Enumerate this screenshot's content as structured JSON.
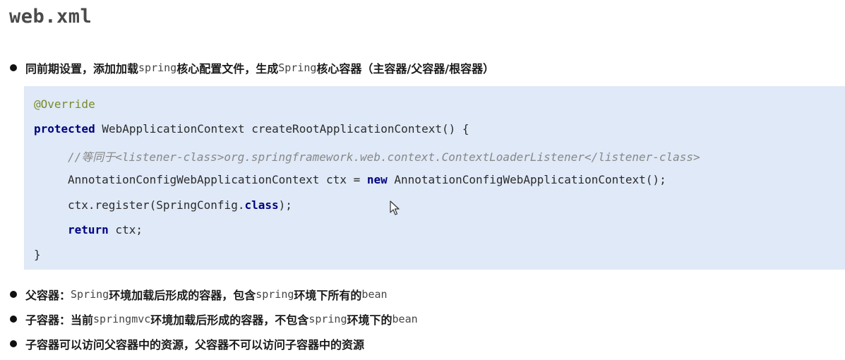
{
  "page_title": "web.xml",
  "bullet1": {
    "p1": "同前期设置，添加加载",
    "m1": "spring",
    "p2": "核心配置文件，生成",
    "m2": "Spring",
    "p3": "核心容器（主容器/父容器/根容器）"
  },
  "code": {
    "annotation": "@Override",
    "kw_protected": "protected",
    "sig": " WebApplicationContext createRootApplicationContext() {",
    "comment": "//等同于<listener-class>org.springframework.web.context.ContextLoaderListener</listener-class>",
    "l3a": "AnnotationConfigWebApplicationContext ctx = ",
    "kw_new": "new",
    "l3b": " AnnotationConfigWebApplicationContext();",
    "l4a": "ctx.register(SpringConfig.",
    "kw_class": "class",
    "l4b": ");",
    "kw_return": "return",
    "l5b": " ctx;",
    "close": "}"
  },
  "bullet2": {
    "p1": "父容器：",
    "m1": "Spring",
    "p2": "环境加载后形成的容器，包含",
    "m2": "spring",
    "p3": "环境下所有的",
    "m3": "bean"
  },
  "bullet3": {
    "p1": "子容器：当前",
    "m1": "springmvc",
    "p2": "环境加载后形成的容器，不包含",
    "m2": "spring",
    "p3": "环境下的",
    "m3": "bean"
  },
  "bullet4": {
    "text": "子容器可以访问父容器中的资源，父容器不可以访问子容器中的资源"
  }
}
